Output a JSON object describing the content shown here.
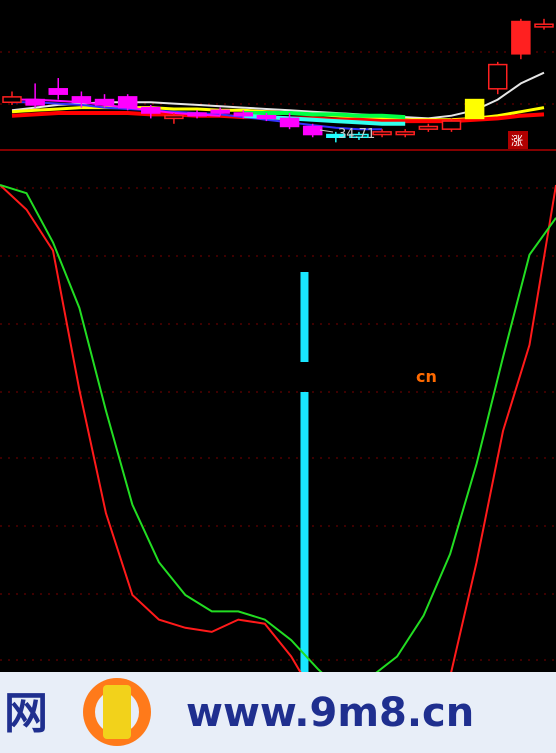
{
  "colors": {
    "background": "#000000",
    "grid": "#7a0000",
    "divider": "#b00000",
    "red_line": "#ff1a1a",
    "green_line": "#22dd22",
    "cyan_bar": "#19e6ff",
    "ma_white": "#e6e6e6",
    "ma_yellow": "#ffff00",
    "ma_red": "#ff0000",
    "ma_blue": "#3333ff",
    "ma_green": "#00ff44",
    "ma_cyan": "#33ffee",
    "ma_magenta": "#ff00ff",
    "candle_up": "#ff2020",
    "candle_down": "#ff00ff",
    "candle_cyan": "#22ffff",
    "candle_yellow": "#ffff00",
    "watermark_band": "#e8eef8",
    "watermark_text": "#1f2f8f",
    "watermark_orange": "#ff6a00"
  },
  "price_panel": {
    "low_marker_label": "34.71",
    "limit_up_badge": "涨"
  },
  "watermark": {
    "left_text": "网",
    "site_text": "www.9m8.cn",
    "faded_text": "cn"
  },
  "chart_data": [
    {
      "type": "candlestick",
      "title": "",
      "candles": [
        {
          "i": 0,
          "o": 36.2,
          "c": 36.4,
          "h": 36.6,
          "l": 36.1
        },
        {
          "i": 1,
          "o": 36.3,
          "c": 36.1,
          "h": 36.9,
          "l": 36.0
        },
        {
          "i": 2,
          "o": 36.7,
          "c": 36.5,
          "h": 37.1,
          "l": 36.3
        },
        {
          "i": 3,
          "o": 36.4,
          "c": 36.2,
          "h": 36.6,
          "l": 36.0
        },
        {
          "i": 4,
          "o": 36.3,
          "c": 36.1,
          "h": 36.5,
          "l": 36.0
        },
        {
          "i": 5,
          "o": 36.4,
          "c": 36.0,
          "h": 36.5,
          "l": 35.9
        },
        {
          "i": 6,
          "o": 36.0,
          "c": 35.8,
          "h": 36.1,
          "l": 35.6
        },
        {
          "i": 7,
          "o": 35.6,
          "c": 35.7,
          "h": 35.8,
          "l": 35.4
        },
        {
          "i": 8,
          "o": 35.8,
          "c": 35.7,
          "h": 35.9,
          "l": 35.6
        },
        {
          "i": 9,
          "o": 35.9,
          "c": 35.8,
          "h": 36.0,
          "l": 35.7
        },
        {
          "i": 10,
          "o": 35.8,
          "c": 35.7,
          "h": 35.9,
          "l": 35.6
        },
        {
          "i": 11,
          "o": 35.7,
          "c": 35.6,
          "h": 35.8,
          "l": 35.5
        },
        {
          "i": 12,
          "o": 35.6,
          "c": 35.3,
          "h": 35.8,
          "l": 35.2
        },
        {
          "i": 13,
          "o": 35.3,
          "c": 35.0,
          "h": 35.4,
          "l": 34.9
        },
        {
          "i": 14,
          "o": 35.0,
          "c": 34.9,
          "h": 35.1,
          "l": 34.71
        },
        {
          "i": 15,
          "o": 34.9,
          "c": 35.0,
          "h": 35.1,
          "l": 34.8
        },
        {
          "i": 16,
          "o": 35.0,
          "c": 35.1,
          "h": 35.2,
          "l": 34.9
        },
        {
          "i": 17,
          "o": 35.0,
          "c": 35.1,
          "h": 35.2,
          "l": 34.9
        },
        {
          "i": 18,
          "o": 35.2,
          "c": 35.3,
          "h": 35.4,
          "l": 35.1
        },
        {
          "i": 19,
          "o": 35.2,
          "c": 35.5,
          "h": 35.6,
          "l": 35.1
        },
        {
          "i": 20,
          "o": 35.6,
          "c": 36.3,
          "h": 36.3,
          "l": 35.6
        },
        {
          "i": 21,
          "o": 36.7,
          "c": 37.6,
          "h": 37.7,
          "l": 36.5
        },
        {
          "i": 22,
          "o": 38.0,
          "c": 39.2,
          "h": 39.3,
          "l": 37.8
        },
        {
          "i": 23,
          "o": 39.0,
          "c": 39.1,
          "h": 39.3,
          "l": 38.9
        }
      ],
      "moving_averages": [
        {
          "color": "white",
          "values": [
            35.9,
            36.0,
            36.1,
            36.15,
            36.2,
            36.2,
            36.2,
            36.15,
            36.1,
            36.05,
            36.0,
            35.95,
            35.9,
            35.85,
            35.8,
            35.75,
            35.7,
            35.65,
            35.6,
            35.7,
            35.9,
            36.3,
            36.9,
            37.3
          ]
        },
        {
          "color": "yellow",
          "values": [
            35.85,
            35.9,
            35.95,
            36.0,
            36.0,
            36.0,
            36.0,
            35.95,
            35.95,
            35.9,
            35.9,
            35.85,
            35.8,
            35.75,
            35.7,
            35.65,
            35.6,
            35.55,
            35.55,
            35.55,
            35.6,
            35.7,
            35.85,
            36.0
          ]
        },
        {
          "color": "red",
          "values": [
            35.7,
            35.75,
            35.8,
            35.8,
            35.8,
            35.8,
            35.75,
            35.75,
            35.7,
            35.7,
            35.65,
            35.65,
            35.6,
            35.6,
            35.55,
            35.55,
            35.5,
            35.5,
            35.5,
            35.5,
            35.55,
            35.6,
            35.7,
            35.75
          ]
        },
        {
          "color": "blue",
          "values": [
            36.2,
            36.2,
            36.15,
            36.1,
            36.0,
            35.95,
            35.9,
            35.85,
            35.8,
            35.75,
            35.65,
            35.55,
            35.45,
            35.35,
            35.25,
            35.2,
            35.2,
            null,
            null,
            null,
            null,
            null,
            null,
            null
          ]
        },
        {
          "color": "green",
          "values": [
            null,
            null,
            null,
            null,
            null,
            null,
            null,
            null,
            null,
            null,
            35.8,
            35.8,
            35.8,
            35.75,
            35.75,
            35.7,
            35.7,
            35.65,
            null,
            null,
            null,
            null,
            null,
            null
          ]
        },
        {
          "color": "cyan",
          "values": [
            null,
            null,
            null,
            null,
            null,
            null,
            null,
            null,
            null,
            null,
            35.7,
            35.65,
            35.6,
            35.55,
            35.5,
            35.45,
            35.4,
            35.4,
            null,
            null,
            null,
            null,
            null,
            null
          ]
        },
        {
          "color": "magenta",
          "values": [
            36.3,
            36.3,
            36.25,
            36.2,
            36.1,
            36.0,
            35.9,
            35.8,
            35.75,
            35.7,
            null,
            null,
            null,
            null,
            null,
            null,
            null,
            null,
            null,
            null,
            null,
            null,
            null,
            null
          ]
        }
      ],
      "low_marker": 34.71
    },
    {
      "type": "line",
      "title": "",
      "xlabel": "",
      "ylabel": "",
      "ylim": [
        0,
        100
      ],
      "grid": true,
      "x": [
        0,
        1,
        2,
        3,
        4,
        5,
        6,
        7,
        8,
        9,
        10,
        11,
        12,
        13,
        14,
        15,
        16,
        17,
        18,
        19,
        20,
        21
      ],
      "series": [
        {
          "color": "red",
          "values": [
            100,
            94,
            84,
            50,
            20,
            0,
            -6,
            -8,
            -9,
            -6,
            -7,
            -15,
            -26,
            -31,
            -28,
            -25,
            -22,
            -20,
            8,
            40,
            61,
            100
          ]
        },
        {
          "color": "green",
          "values": [
            100,
            98,
            86,
            70,
            45,
            22,
            8,
            0,
            -4,
            -4,
            -6,
            -11,
            -18,
            -24,
            -20,
            -15,
            -5,
            10,
            32,
            58,
            83,
            92
          ]
        }
      ],
      "signal_bar": {
        "x": 11.5
      }
    }
  ]
}
